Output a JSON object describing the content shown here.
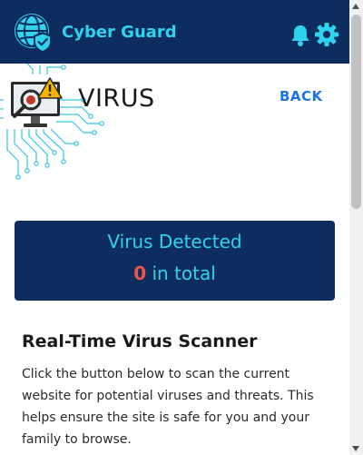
{
  "header": {
    "app_title": "Cyber Guard",
    "logo_icon": "globe-shield-icon",
    "notification_icon": "bell-icon",
    "settings_icon": "gear-icon",
    "background_color": "#0d2d5e",
    "accent_color": "#2fd3f0"
  },
  "hero": {
    "illustration_icon": "virus-monitor-icon",
    "page_title": "VIRUS",
    "back_label": "BACK"
  },
  "status_card": {
    "title": "Virus Detected",
    "count": "0",
    "count_suffix": "in total",
    "count_color": "#e8594b"
  },
  "scanner": {
    "heading": "Real-Time Virus Scanner",
    "description": "Click the button below to scan the current website for potential viruses and threats. This helps ensure the site is safe for you and your family to browse."
  }
}
